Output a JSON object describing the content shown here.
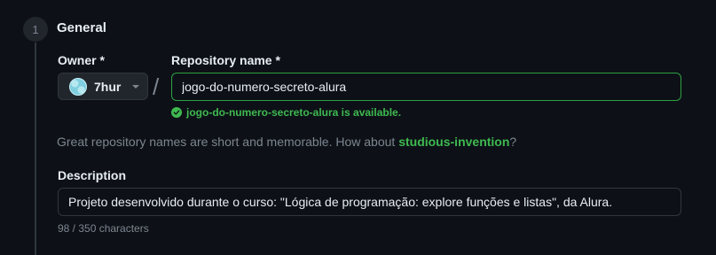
{
  "step": {
    "number": "1",
    "title": "General"
  },
  "owner": {
    "label": "Owner *",
    "value": "7hur",
    "avatar_icon": "avatar-icon"
  },
  "separator": "/",
  "repository": {
    "label": "Repository name *",
    "value": "jogo-do-numero-secreto-alura",
    "availability_message": "jogo-do-numero-secreto-alura is available.",
    "availability_color": "#3fb950"
  },
  "suggestion": {
    "prefix": "Great repository names are short and memorable. How about ",
    "name": "studious-invention",
    "suffix": "?"
  },
  "description": {
    "label": "Description",
    "value": "Projeto desenvolvido durante o curso: \"Lógica de programação: explore funções e listas\", da Alura.",
    "char_count": "98 / 350 characters"
  },
  "colors": {
    "background": "#0d1117",
    "accent_green": "#3fb950",
    "border": "#30363d",
    "muted_text": "#7d8590"
  }
}
